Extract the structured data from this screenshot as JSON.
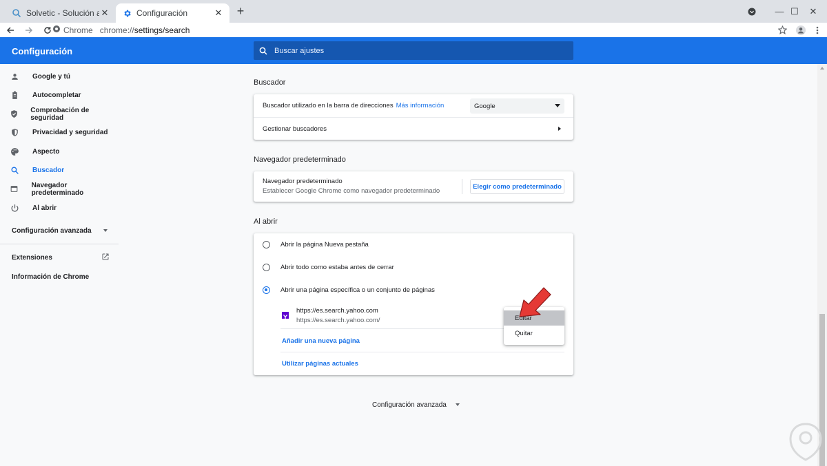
{
  "tabs": [
    {
      "title": "Solvetic - Solución a los problemas",
      "icon": "search-favicon"
    },
    {
      "title": "Configuración",
      "icon": "gear-icon"
    }
  ],
  "toolbar": {
    "site_label": "Chrome",
    "url_scheme": "chrome://",
    "url_path": "settings/search"
  },
  "header": {
    "title": "Configuración",
    "search_placeholder": "Buscar ajustes"
  },
  "sidebar": {
    "items": [
      {
        "label": "Google y tú",
        "icon": "person-icon"
      },
      {
        "label": "Autocompletar",
        "icon": "clipboard-icon"
      },
      {
        "label": "Comprobación de seguridad",
        "icon": "shield-check-icon"
      },
      {
        "label": "Privacidad y seguridad",
        "icon": "shield-icon"
      },
      {
        "label": "Aspecto",
        "icon": "palette-icon"
      },
      {
        "label": "Buscador",
        "icon": "search-icon"
      },
      {
        "label": "Navegador predeterminado",
        "icon": "browser-icon"
      },
      {
        "label": "Al abrir",
        "icon": "power-icon"
      }
    ],
    "advanced": "Configuración avanzada",
    "extensions": "Extensiones",
    "about": "Información de Chrome"
  },
  "search_engine": {
    "title": "Buscador",
    "row1_label": "Buscador utilizado en la barra de direcciones",
    "row1_link": "Más información",
    "selected_engine": "Google",
    "row2_label": "Gestionar buscadores"
  },
  "default_browser": {
    "title": "Navegador predeterminado",
    "label": "Navegador predeterminado",
    "sublabel": "Establecer Google Chrome como navegador predeterminado",
    "button": "Elegir como predeterminado"
  },
  "on_startup": {
    "title": "Al abrir",
    "options": [
      {
        "label": "Abrir la página Nueva pestaña",
        "checked": false
      },
      {
        "label": "Abrir todo como estaba antes de cerrar",
        "checked": false
      },
      {
        "label": "Abrir una página específica o un conjunto de páginas",
        "checked": true
      }
    ],
    "page_title": "https://es.search.yahoo.com",
    "page_url": "https://es.search.yahoo.com/",
    "add_page": "Añadir una nueva página",
    "use_current": "Utilizar páginas actuales"
  },
  "context_menu": {
    "edit": "Editar",
    "remove": "Quitar"
  },
  "footer_advanced": "Configuración avanzada",
  "colors": {
    "accent": "#1a73e8",
    "header_search": "#1557b0",
    "arrow": "#e53935"
  }
}
